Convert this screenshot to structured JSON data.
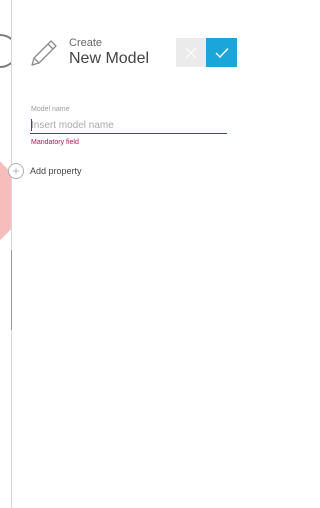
{
  "header": {
    "subtitle": "Create",
    "title": "New Model",
    "icon": "pencil-icon"
  },
  "actions": {
    "cancel_icon": "close-icon",
    "confirm_icon": "check-icon",
    "confirm_color": "#1ba6d9"
  },
  "form": {
    "model_name_label": "Model name",
    "model_name_value": "",
    "model_name_placeholder": "Insert model name",
    "model_name_error": "Mandatory field",
    "error_color": "#b01555"
  },
  "add_property": {
    "icon": "plus-circle-icon",
    "label": "Add property"
  }
}
